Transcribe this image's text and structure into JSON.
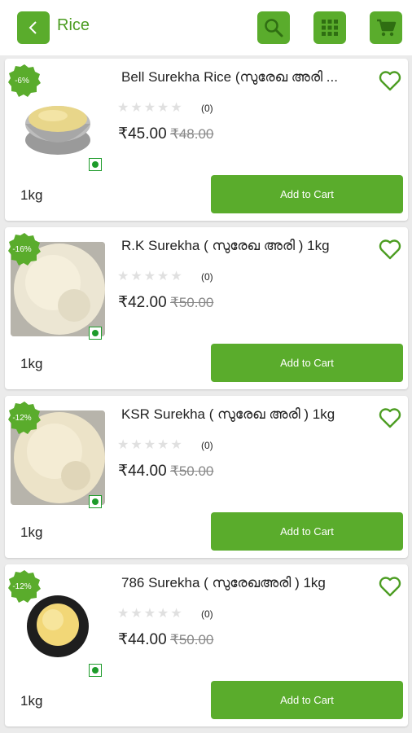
{
  "header": {
    "title": "Rice",
    "icons": [
      "back-icon",
      "search-icon",
      "grid-icon",
      "cart-icon"
    ]
  },
  "colors": {
    "accent": "#5aac2c",
    "title": "#4c9d22",
    "veg": "#1d9b2a"
  },
  "products": [
    {
      "discount": "-6%",
      "name": "Bell Surekha Rice (സുരേഖ അരി ...",
      "rating_count": "(0)",
      "price": "₹45.00",
      "mrp": "₹48.00",
      "weight": "1kg",
      "add_to_cart": "Add to Cart",
      "stars": 0
    },
    {
      "discount": "-16%",
      "name": "R.K Surekha ( സുരേഖ അരി ) 1kg",
      "rating_count": "(0)",
      "price": "₹42.00",
      "mrp": "₹50.00",
      "weight": "1kg",
      "add_to_cart": "Add to Cart",
      "stars": 0
    },
    {
      "discount": "-12%",
      "name": "KSR Surekha ( സുരേഖ അരി ) 1kg",
      "rating_count": "(0)",
      "price": "₹44.00",
      "mrp": "₹50.00",
      "weight": "1kg",
      "add_to_cart": "Add to Cart",
      "stars": 0
    },
    {
      "discount": "-12%",
      "name": "786 Surekha ( സുരേഖഅരി ) 1kg",
      "rating_count": "(0)",
      "price": "₹44.00",
      "mrp": "₹50.00",
      "weight": "1kg",
      "add_to_cart": "Add to Cart",
      "stars": 0
    }
  ]
}
